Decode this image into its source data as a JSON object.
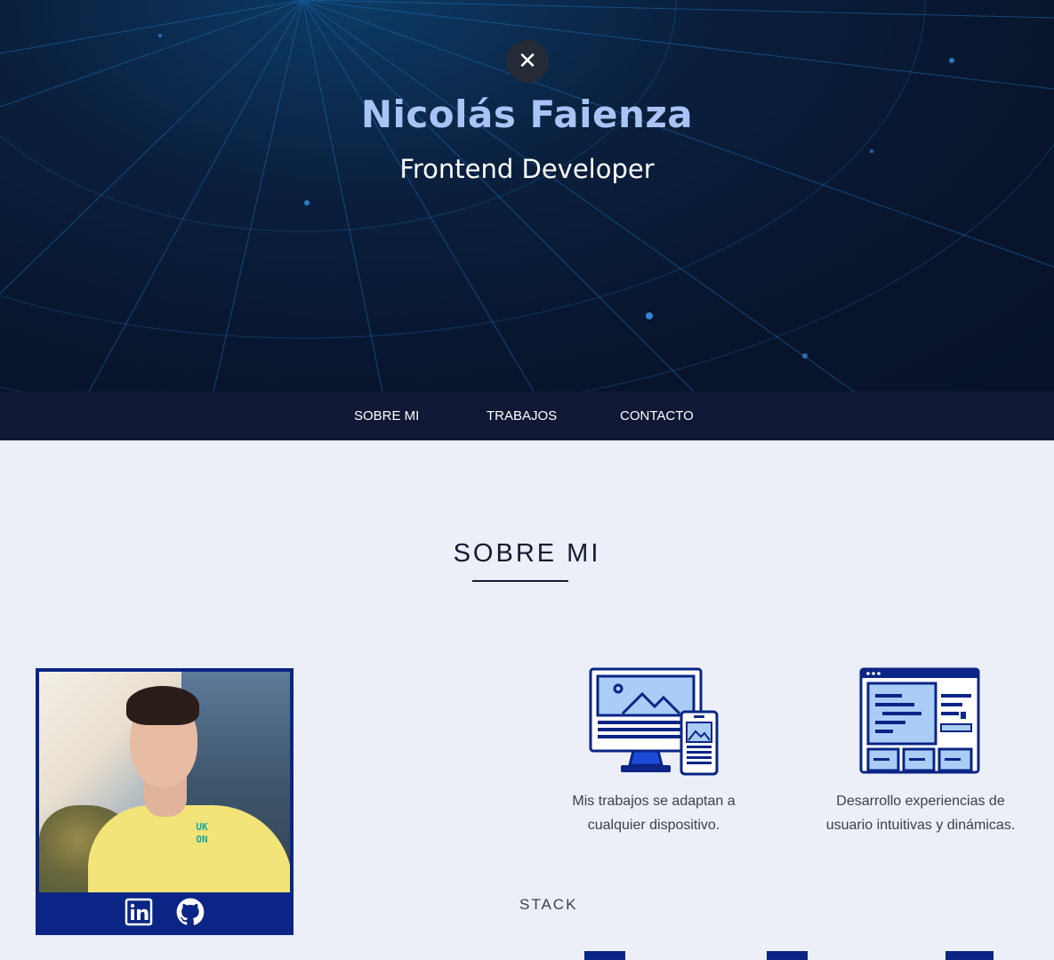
{
  "hero": {
    "close_label": "✕",
    "name": "Nicolás Faienza",
    "role": "Frontend Developer"
  },
  "nav": {
    "items": [
      "SOBRE MI",
      "TRABAJOS",
      "CONTACTO"
    ]
  },
  "about": {
    "title": "SOBRE MI",
    "features": [
      {
        "icon": "responsive-devices-icon",
        "line1": "Mis trabajos se adaptan a",
        "line2": "cualquier dispositivo."
      },
      {
        "icon": "ui-layout-icon",
        "line1": "Desarrollo experiencias de",
        "line2": "usuario intuitivas y dinámicas."
      }
    ],
    "stack_title": "STACK"
  },
  "profile": {
    "shirt_logo": "UK ON",
    "social": [
      "linkedin-icon",
      "github-icon"
    ]
  },
  "colors": {
    "hero_bg": "#08152d",
    "name": "#a9c3f5",
    "nav_bg": "#111836",
    "page_bg": "#eceff7",
    "accent": "#0a2585"
  }
}
